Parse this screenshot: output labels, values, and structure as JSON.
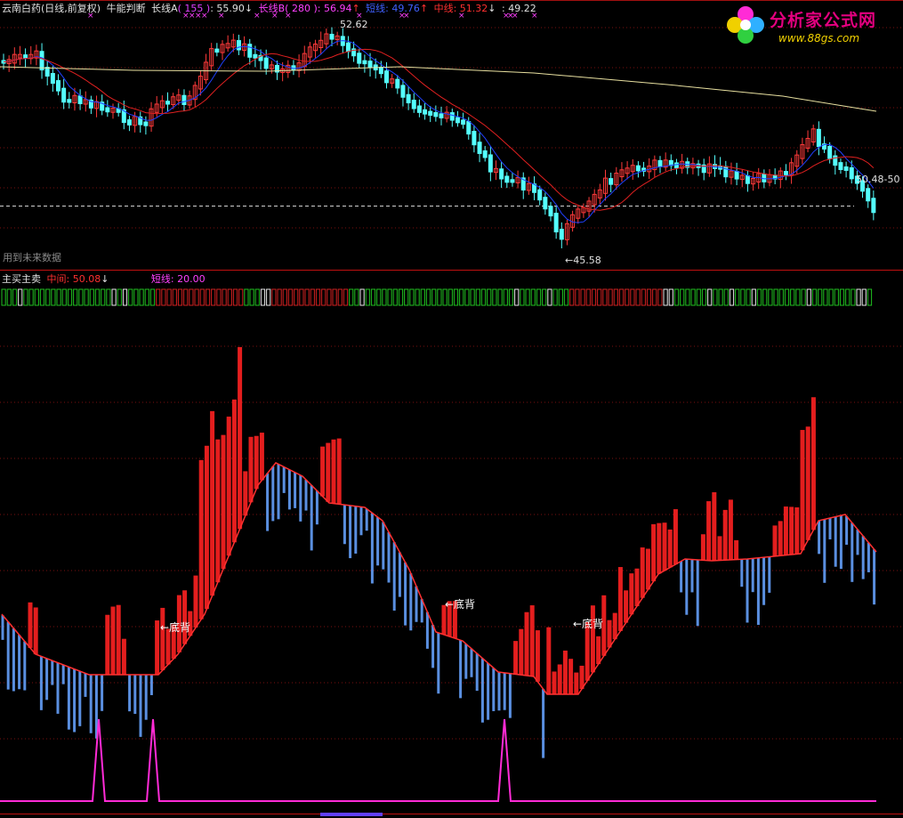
{
  "main_header": {
    "stock": "云南白药(日线,前复权)",
    "indicator": "牛能判断",
    "longA_label": "长线A",
    "longA_param": "( 155 )",
    "longA_value": ": 55.90",
    "longA_arrow": "↓",
    "longB_label": "长线B",
    "longB_param": "( 280 )",
    "longB_value": ": 56.94",
    "longB_arrow": "↑",
    "short_label": "短线",
    "short_value": ": 49.76",
    "short_arrow": "↑",
    "mid_label": "中线",
    "mid_value": ": 51.32",
    "mid_arrow": "↓",
    "extra_value": ": 49.22"
  },
  "price_annotations": {
    "high_label": "52.62",
    "low_label": "←45.58",
    "current_label": "50.48-50",
    "note": "用到未来数据"
  },
  "sub_header": {
    "title": "主买主卖",
    "mid_label": "中间",
    "mid_value": ": 50.08",
    "mid_arrow": "↓",
    "short_label": "短线",
    "short_value": ": 20.00"
  },
  "divergence_label": "←底背",
  "logo": {
    "title": "分析家公式网",
    "url": "www.88gs.com"
  },
  "colors": {
    "up": "#ff3a3a",
    "down": "#54ffff",
    "ma_red": "#e02020",
    "ma_blue": "#2040ff",
    "ma_yellow": "#e8e0a0",
    "bar_red": "#e41e1e",
    "bar_blue": "#5a8fe0",
    "pink": "#ff2bd6",
    "grid": "#7a1010"
  }
}
